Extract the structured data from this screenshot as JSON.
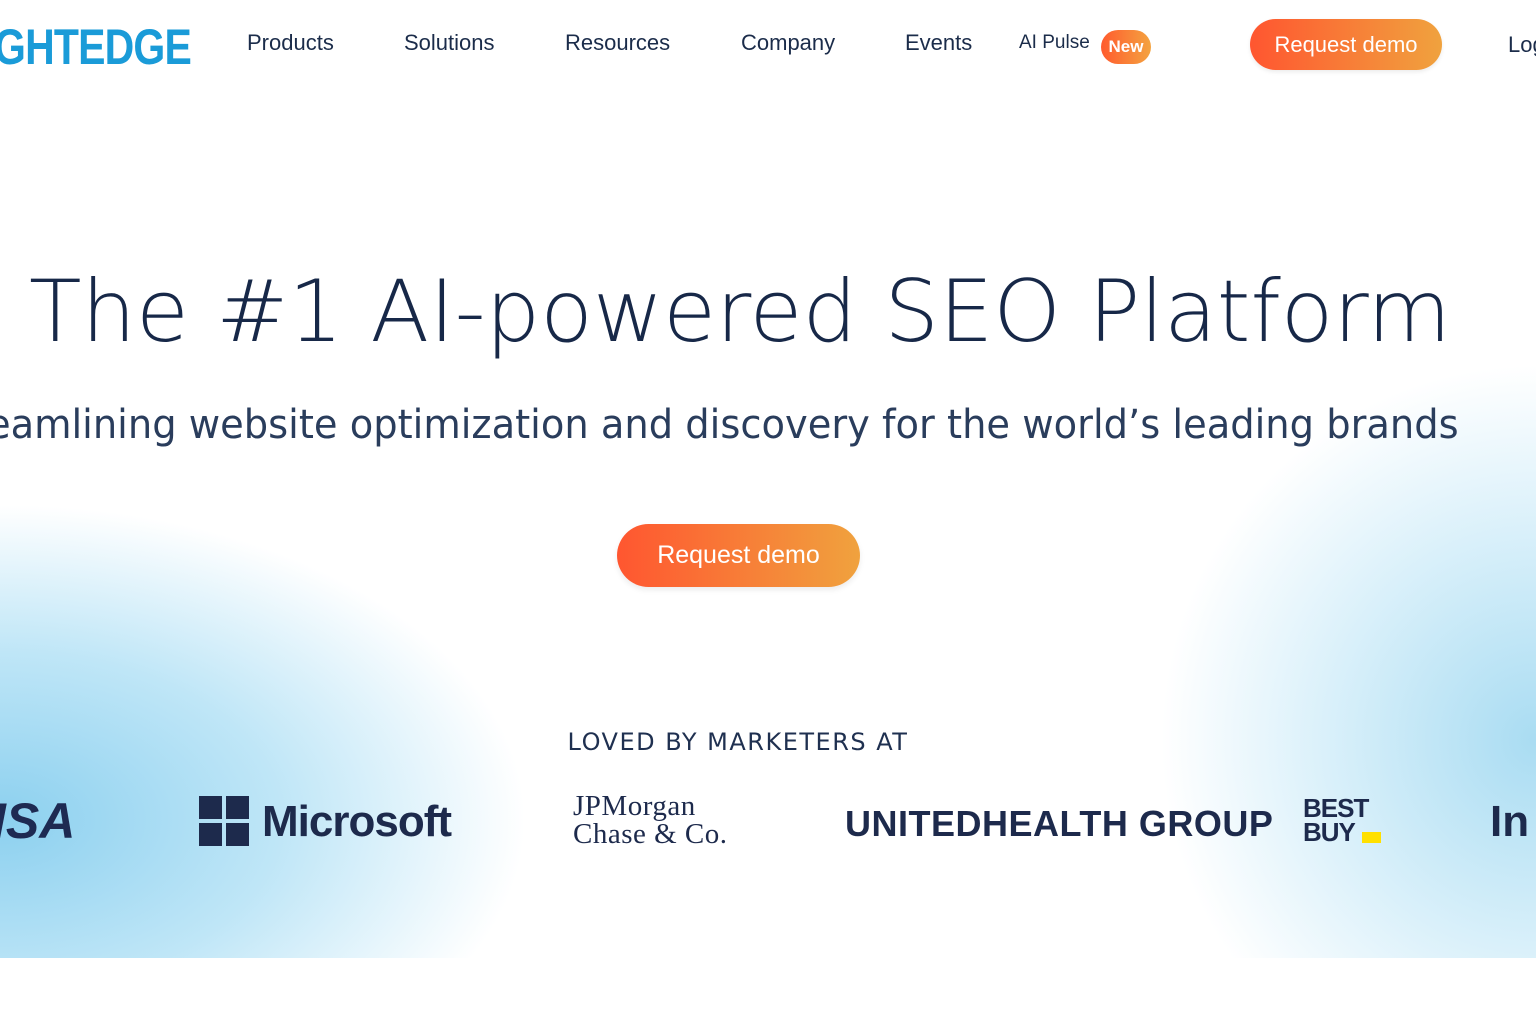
{
  "header": {
    "logo_text": "GHTEDGE",
    "nav": [
      {
        "label": "Products"
      },
      {
        "label": "Solutions"
      },
      {
        "label": "Resources"
      },
      {
        "label": "Company"
      },
      {
        "label": "Events"
      }
    ],
    "ai_pulse": {
      "label": "AI Pulse",
      "badge": "New"
    },
    "cta_label": "Request demo",
    "login_label": "Log"
  },
  "hero": {
    "title": "The #1 AI-powered SEO Platform",
    "subtitle": "reamlining website optimization and discovery for the world’s leading brands",
    "cta_label": "Request demo"
  },
  "customers": {
    "heading": "LOVED BY MARKETERS AT",
    "logos": {
      "visa": "ISA",
      "microsoft": "Microsoft",
      "jpmorgan_line1": "JPMorgan",
      "jpmorgan_line2": "Chase & Co.",
      "unitedhealth": "UNITEDHEALTH GROUP",
      "bestbuy_line1": "BEST",
      "bestbuy_line2": "BUY",
      "partial": "In"
    }
  },
  "colors": {
    "brand_blue": "#1a9bd8",
    "cta_gradient_start": "#ff5630",
    "cta_gradient_end": "#f0a23e",
    "text_dark": "#172848"
  }
}
